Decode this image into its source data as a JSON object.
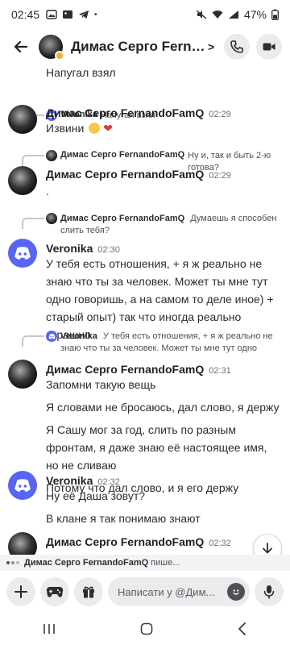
{
  "status_bar": {
    "time": "02:45",
    "battery": "47%"
  },
  "header": {
    "title": "Димас Серго FernandoFamQ",
    "chevron": ">"
  },
  "chat": {
    "prev_tail": "Напугал взял",
    "messages": [
      {
        "reply": {
          "author": "Veronika",
          "text": "Напугал взял"
        },
        "author": "Димас Серго FernandoFamQ",
        "time": "02:29",
        "lines": [
          "Извини"
        ]
      },
      {
        "reply": {
          "author": "Димас Серго FernandoFamQ",
          "text": "Ну и, так и быть 2-ю готова?"
        },
        "author": "Димас Серго FernandoFamQ",
        "time": "02:29",
        "lines": [
          "."
        ]
      },
      {
        "reply": {
          "author": "Димас Серго FernandoFamQ",
          "text": "Думаешь я способен слить тебя?"
        },
        "author": "Veronika",
        "time": "02:30",
        "lines": [
          "У тебя есть отношения, + я ж реально не знаю что ты за человек. Может ты мне тут одно говоришь, а на самом то деле иное) + старый опыт) так что иногда реально страшно"
        ]
      },
      {
        "reply": {
          "author": "Veronika",
          "text": "У тебя есть отношения, + я ж реально не знаю что ты за человек. Может ты мне тут одно говоришь, а на"
        },
        "author": "Димас Серго FernandoFamQ",
        "time": "02:31",
        "lines": [
          "Запомни такую вещь",
          "Я словами не бросаюсь, дал слово, я держу",
          "Я Сашу мог за год, слить по разным фронтам, я даже знаю её настоящее имя, но не сливаю",
          "Потому что дал слово, и я его держу"
        ]
      },
      {
        "author": "Veronika",
        "time": "02:32",
        "lines": [
          "Ну её Даша зовут?",
          "В клане я так понимаю знают"
        ]
      },
      {
        "author": "Димас Серго FernandoFamQ",
        "time": "02:32",
        "lines": []
      }
    ]
  },
  "typing": {
    "name": "Димас Серго FernandoFamQ",
    "suffix": "пише..."
  },
  "composer": {
    "placeholder": "Написати у @Дим..."
  },
  "colors": {
    "accent": "#5865f2",
    "away": "#f0b232",
    "heart": "#e53935"
  }
}
